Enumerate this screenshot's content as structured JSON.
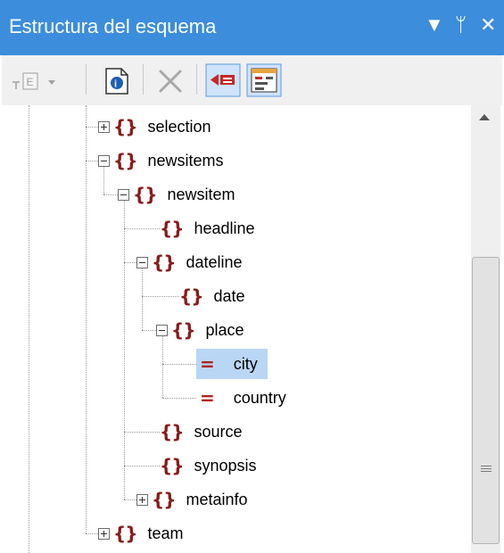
{
  "panel": {
    "title": "Estructura del esquema",
    "controls": {
      "dropdown": "▼",
      "pin": "ᛘ",
      "close": "✕"
    }
  },
  "toolbar": {
    "buttons": [
      {
        "icon": "insert-element-icon",
        "enabled": false,
        "has_dropdown": true
      },
      {
        "icon": "properties-icon",
        "enabled": true
      },
      {
        "icon": "delete-icon",
        "enabled": false
      },
      {
        "icon": "sort-icon",
        "enabled": true,
        "pressed": true
      },
      {
        "icon": "diagram-icon",
        "enabled": true
      }
    ]
  },
  "tree": {
    "nodes": [
      {
        "label": "selection",
        "kind": "element",
        "expander": "plus"
      },
      {
        "label": "newsitems",
        "kind": "element",
        "expander": "minus"
      },
      {
        "label": "newsitem",
        "kind": "element",
        "expander": "minus"
      },
      {
        "label": "headline",
        "kind": "element",
        "expander": "none"
      },
      {
        "label": "dateline",
        "kind": "element",
        "expander": "minus"
      },
      {
        "label": "date",
        "kind": "element",
        "expander": "none"
      },
      {
        "label": "place",
        "kind": "element",
        "expander": "minus"
      },
      {
        "label": "city",
        "kind": "attribute",
        "expander": "none",
        "selected": true
      },
      {
        "label": "country",
        "kind": "attribute",
        "expander": "none"
      },
      {
        "label": "source",
        "kind": "element",
        "expander": "none"
      },
      {
        "label": "synopsis",
        "kind": "element",
        "expander": "none"
      },
      {
        "label": "metainfo",
        "kind": "element",
        "expander": "plus"
      },
      {
        "label": "team",
        "kind": "element",
        "expander": "plus"
      }
    ]
  },
  "colors": {
    "title_bar": "#3c8ddb",
    "element_icon": "#8b1a1a",
    "selection": "#bad6f5"
  }
}
